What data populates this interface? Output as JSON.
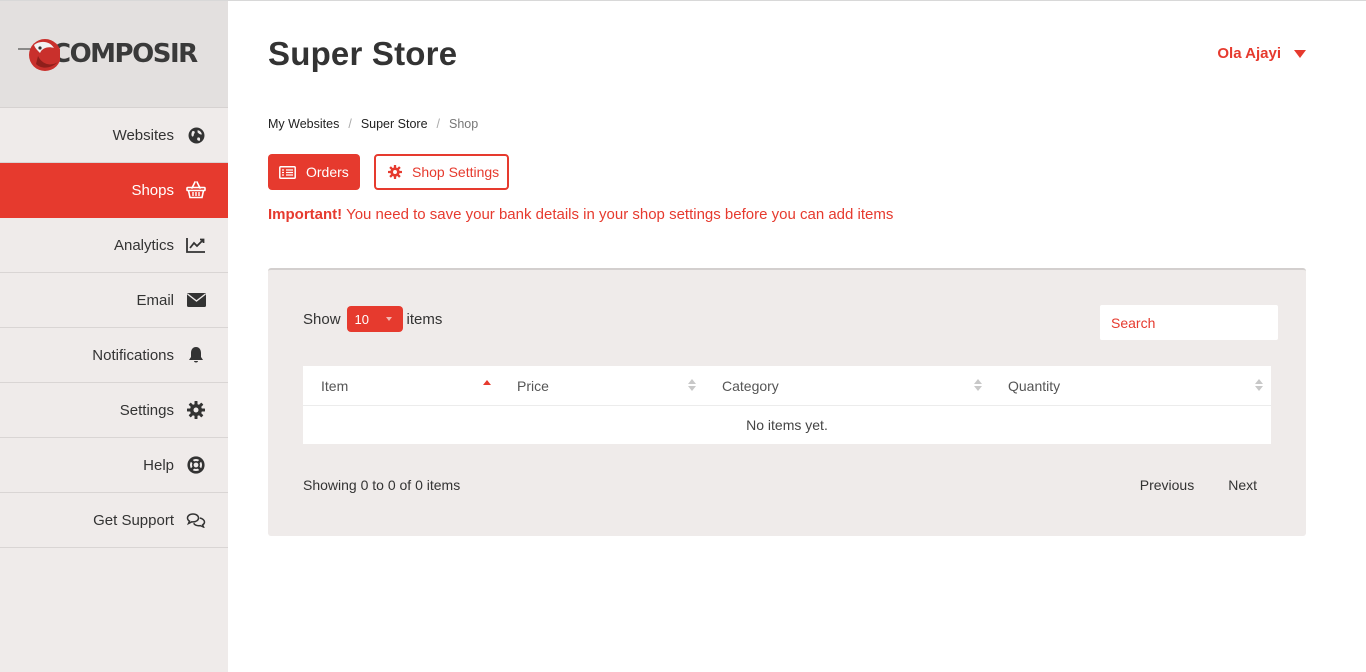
{
  "brand": {
    "logo_text": "COMPOSIR",
    "accent": "#e63a2e"
  },
  "sidebar": {
    "items": [
      {
        "label": "Websites",
        "icon": "globe-icon",
        "active": false
      },
      {
        "label": "Shops",
        "icon": "basket-icon",
        "active": true
      },
      {
        "label": "Analytics",
        "icon": "line-chart-icon",
        "active": false
      },
      {
        "label": "Email",
        "icon": "envelope-icon",
        "active": false
      },
      {
        "label": "Notifications",
        "icon": "bell-icon",
        "active": false
      },
      {
        "label": "Settings",
        "icon": "gear-icon",
        "active": false
      },
      {
        "label": "Help",
        "icon": "lifebuoy-icon",
        "active": false
      },
      {
        "label": "Get Support",
        "icon": "chat-icon",
        "active": false
      }
    ]
  },
  "header": {
    "title": "Super Store",
    "user_name": "Ola Ajayi"
  },
  "breadcrumb": {
    "items": [
      "My Websites",
      "Super Store"
    ],
    "current": "Shop"
  },
  "actions": {
    "orders_label": "Orders",
    "settings_label": "Shop Settings"
  },
  "alert": {
    "strong": "Important!",
    "text": " You need to save your bank details in your shop settings before you can add items"
  },
  "table_controls": {
    "show_label": "Show",
    "page_size": "10",
    "items_label": "items",
    "search_placeholder": "Search"
  },
  "table": {
    "columns": [
      {
        "label": "Item",
        "sort": "asc"
      },
      {
        "label": "Price",
        "sort": "none"
      },
      {
        "label": "Category",
        "sort": "none"
      },
      {
        "label": "Quantity",
        "sort": "none"
      }
    ],
    "empty_text": "No items yet."
  },
  "footer": {
    "info": "Showing 0 to 0 of 0 items",
    "previous": "Previous",
    "next": "Next"
  }
}
